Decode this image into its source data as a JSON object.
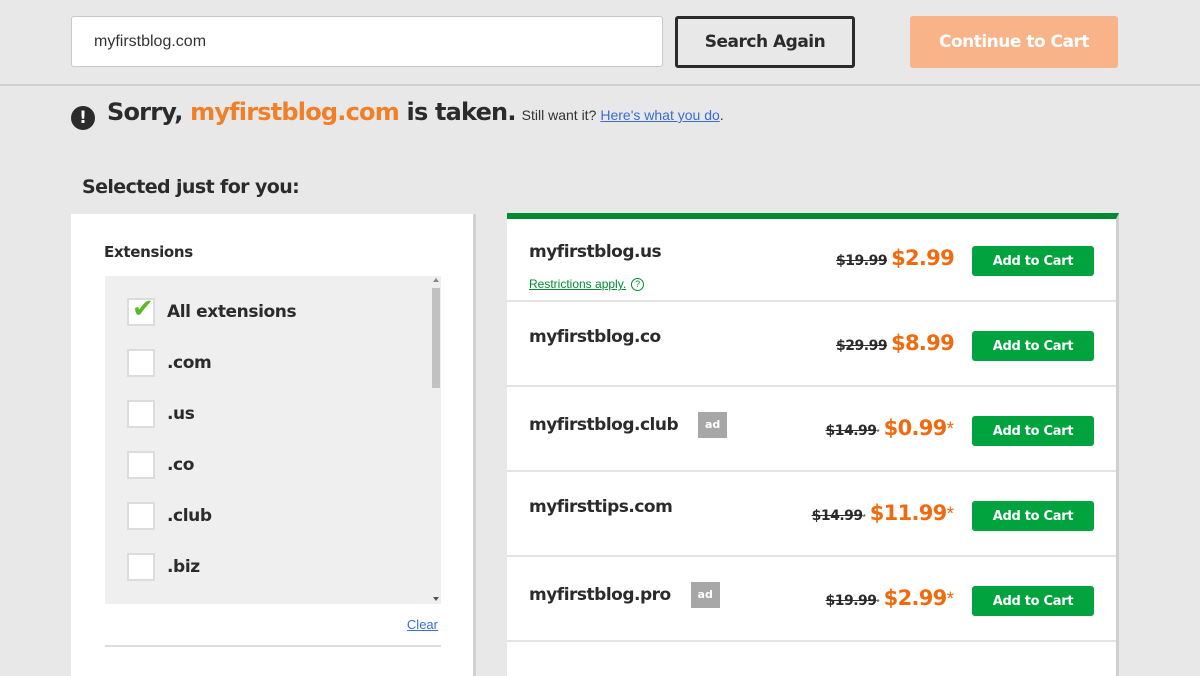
{
  "search": {
    "value": "myfirstblog.com",
    "search_again_label": "Search Again",
    "continue_label": "Continue to Cart"
  },
  "alert": {
    "icon": "exclamation-icon",
    "prefix": "Sorry,",
    "domain": "myfirstblog.com",
    "suffix": "is taken.",
    "still_want": "Still want it?",
    "link": "Here's what you do",
    "dot": "."
  },
  "selected_heading": "Selected just for you:",
  "filters": {
    "title": "Extensions",
    "items": [
      {
        "label": "All extensions",
        "checked": true
      },
      {
        "label": ".com",
        "checked": false
      },
      {
        "label": ".us",
        "checked": false
      },
      {
        "label": ".co",
        "checked": false
      },
      {
        "label": ".club",
        "checked": false
      },
      {
        "label": ".biz",
        "checked": false
      }
    ],
    "check_glyph": "✔",
    "clear_label": "Clear"
  },
  "results": [
    {
      "domain": "myfirstblog.us",
      "ad": false,
      "restrictions": "Restrictions apply.",
      "help": "?",
      "old_price": "$19.99",
      "old_star": "",
      "new_price": "$2.99",
      "new_star": "",
      "button": "Add to Cart"
    },
    {
      "domain": "myfirstblog.co",
      "ad": false,
      "restrictions": "",
      "old_price": "$29.99",
      "old_star": "",
      "new_price": "$8.99",
      "new_star": "",
      "button": "Add to Cart"
    },
    {
      "domain": "myfirstblog.club",
      "ad": true,
      "ad_label": "ad",
      "restrictions": "",
      "old_price": "$14.99",
      "old_star": "*",
      "new_price": "$0.99",
      "new_star": "*",
      "button": "Add to Cart"
    },
    {
      "domain": "myfirsttips.com",
      "ad": false,
      "restrictions": "",
      "old_price": "$14.99",
      "old_star": "*",
      "new_price": "$11.99",
      "new_star": "*",
      "button": "Add to Cart"
    },
    {
      "domain": "myfirstblog.pro",
      "ad": true,
      "ad_label": "ad",
      "restrictions": "",
      "old_price": "$19.99",
      "old_star": "*",
      "new_price": "$2.99",
      "new_star": "*",
      "button": "Add to Cart"
    }
  ],
  "colors": {
    "brand_orange": "#f07f27",
    "price_orange": "#f06a0f",
    "cart_green": "#00a33d",
    "accent_green": "#008a32",
    "continue_disabled": "#f8b488",
    "link_blue": "#3b6bd6"
  }
}
